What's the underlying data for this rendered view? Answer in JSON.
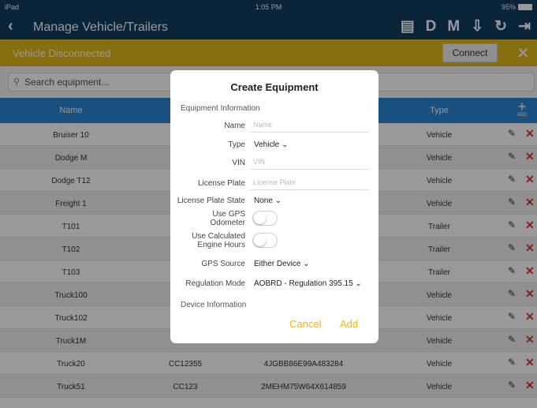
{
  "status_bar": {
    "left": "iPad",
    "wifi": "wifi-icon",
    "time": "1:05 PM",
    "battery_pct": "95%",
    "icons": "location-arrow-icon bluetooth-icon battery-icon"
  },
  "nav": {
    "back_glyph": "‹",
    "title": "Manage Vehicle/Trailers",
    "actions": [
      {
        "name": "message-icon",
        "glyph": "▤"
      },
      {
        "name": "d-status",
        "glyph": "D"
      },
      {
        "name": "m-status",
        "glyph": "M"
      },
      {
        "name": "download-icon",
        "glyph": "⇩"
      },
      {
        "name": "refresh-icon",
        "glyph": "↻"
      },
      {
        "name": "logout-icon",
        "glyph": "⇥"
      }
    ]
  },
  "banner": {
    "text": "Vehicle Disconnected",
    "connect_label": "Connect",
    "close_glyph": "✕",
    "color": "#e1b81c"
  },
  "search": {
    "placeholder": "Search equipment...",
    "icon": "search-icon",
    "icon_glyph": "⚲"
  },
  "table": {
    "headers": {
      "name": "Name",
      "type": "Type",
      "add": "ADD",
      "add_glyph": "+"
    },
    "rows": [
      {
        "name": "Bruiser 10",
        "number": "",
        "vin": "",
        "type": "Vehicle"
      },
      {
        "name": "Dodge M",
        "number": "",
        "vin": "",
        "type": "Vehicle"
      },
      {
        "name": "Dodge T12",
        "number": "",
        "vin": "",
        "type": "Vehicle"
      },
      {
        "name": "Freight 1",
        "number": "",
        "vin": "",
        "type": "Vehicle"
      },
      {
        "name": "T101",
        "number": "",
        "vin": "",
        "type": "Trailer"
      },
      {
        "name": "T102",
        "number": "",
        "vin": "",
        "type": "Trailer"
      },
      {
        "name": "T103",
        "number": "",
        "vin": "",
        "type": "Trailer"
      },
      {
        "name": "Truck100",
        "number": "",
        "vin": "",
        "type": "Vehicle"
      },
      {
        "name": "Truck102",
        "number": "",
        "vin": "",
        "type": "Vehicle"
      },
      {
        "name": "Truck1M",
        "number": "",
        "vin": "",
        "type": "Vehicle"
      },
      {
        "name": "Truck20",
        "number": "CC12355",
        "vin": "4JGBB86E99A483284",
        "type": "Vehicle"
      },
      {
        "name": "Truck51",
        "number": "CC123",
        "vin": "2MEHM75W64X614859",
        "type": "Vehicle"
      }
    ],
    "edit_glyph": "✎",
    "delete_glyph": "✕",
    "accent": "#2a86d4",
    "delete_color": "#d9342b"
  },
  "modal": {
    "title": "Create Equipment",
    "section_equipment": "Equipment Information",
    "name_label": "Name",
    "name_placeholder": "Name",
    "type_label": "Type",
    "type_value": "Vehicle ⌄",
    "vin_label": "VIN",
    "vin_placeholder": "VIN",
    "plate_label": "License Plate",
    "plate_placeholder": "License Plate",
    "plate_state_label": "License Plate State",
    "plate_state_value": "None ⌄",
    "gps_odo_label_1": "Use GPS",
    "gps_odo_label_2": "Odometer",
    "gps_odo_on": false,
    "calc_hours_label_1": "Use Calculated",
    "calc_hours_label_2": "Engine Hours",
    "calc_hours_on": false,
    "gps_source_label": "GPS Source",
    "gps_source_value": "Either Device ⌄",
    "reg_mode_label": "Regulation Mode",
    "reg_mode_value": "AOBRD - Regulation 395.15 ⌄",
    "section_device": "Device Information",
    "cancel_label": "Cancel",
    "add_label": "Add",
    "button_color": "#f2b321"
  }
}
